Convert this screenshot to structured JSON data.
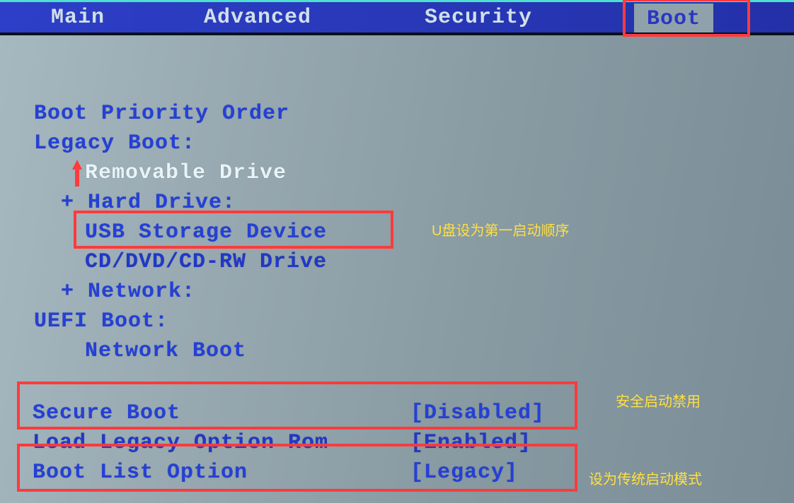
{
  "menu": {
    "main": "Main",
    "advanced": "Advanced",
    "security": "Security",
    "boot": "Boot"
  },
  "body": {
    "bootPriorityOrder": "Boot Priority Order",
    "legacyBoot": "Legacy Boot:",
    "removableDrive": "Removable Drive",
    "hardDrivePlus": "+ Hard Drive:",
    "usbStorage": "USB Storage Device",
    "cddvd": "CD/DVD/CD-RW Drive",
    "networkPlus": "+ Network:",
    "uefiBoot": "UEFI Boot:",
    "networkBoot": "Network Boot",
    "secureBootLabel": "Secure Boot",
    "secureBootValue": "[Disabled]",
    "loadLegacyLabel": "Load Legacy Option Rom",
    "loadLegacyValue": "[Enabled]",
    "bootListLabel": "Boot List Option",
    "bootListValue": "[Legacy]"
  },
  "annotations": {
    "usbFirst": "U盘设为第一启动顺序",
    "secureDisable": "安全启动禁用",
    "legacyMode": "设为传统启动模式"
  }
}
